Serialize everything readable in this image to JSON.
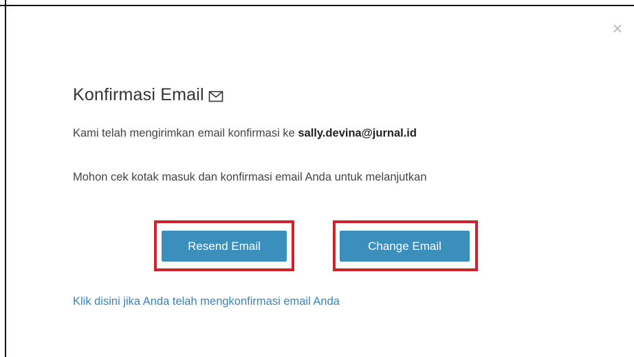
{
  "modal": {
    "close_glyph": "×",
    "title": "Konfirmasi Email",
    "title_icon": "envelope-icon",
    "sent_text": "Kami telah mengirimkan email konfirmasi ke ",
    "email": "sally.devina@jurnal.id",
    "instruction_text": "Mohon cek kotak masuk dan konfirmasi email Anda untuk melanjutkan",
    "resend_button_label": "Resend Email",
    "change_button_label": "Change Email",
    "confirmed_link_text": "Klik disini jika Anda telah mengkonfirmasi email Anda"
  },
  "colors": {
    "button_bg": "#3a8fbc",
    "highlight_border": "#d4202a",
    "link": "#3a84b8"
  }
}
